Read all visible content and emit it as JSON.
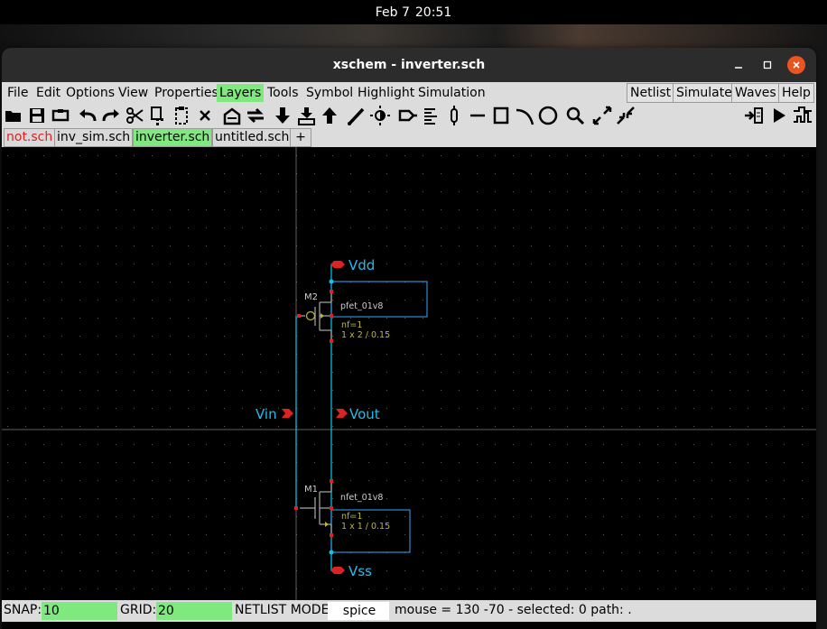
{
  "topbar": {
    "date": "Feb 7",
    "time": "20:51"
  },
  "window": {
    "title": "xschem - inverter.sch"
  },
  "menubar": {
    "items": [
      "File",
      "Edit",
      "Options",
      "View",
      "Properties",
      "Layers",
      "Tools",
      "Symbol",
      "Highlight",
      "Simulation"
    ],
    "active": "Layers",
    "right_buttons": [
      "Netlist",
      "Simulate",
      "Waves",
      "Help"
    ]
  },
  "toolbar": {
    "icons": [
      "open-folder-icon",
      "save-icon",
      "reload-icon",
      "undo-icon",
      "redo-icon",
      "cut-icon",
      "copy-icon",
      "paste-icon",
      "delete-icon",
      "rotate-icon",
      "flip-icon",
      "push-down-icon",
      "descend-symbol-icon",
      "go-up-icon",
      "wire-pencil-icon",
      "highlight-icon",
      "pin-icon",
      "text-align-icon",
      "resistor-icon",
      "line-icon",
      "rect-icon",
      "arc-icon",
      "circle-icon",
      "zoom-icon",
      "zoom-in-icon",
      "zoom-out-icon",
      "netlist-icon",
      "run-icon",
      "waveform-icon"
    ]
  },
  "tabs": [
    {
      "label": "not.sch",
      "state": "modified"
    },
    {
      "label": "inv_sim.sch",
      "state": "normal"
    },
    {
      "label": "inverter.sch",
      "state": "active"
    },
    {
      "label": "untitled.sch",
      "state": "normal"
    },
    {
      "label": "+",
      "state": "add"
    }
  ],
  "schematic": {
    "labels": {
      "vdd": "Vdd",
      "vss": "Vss",
      "vin": "Vin",
      "vout": "Vout"
    },
    "pmos": {
      "name": "M2",
      "model": "pfet_01v8",
      "nf": "nf=1",
      "size": "1 x 2 / 0.15"
    },
    "nmos": {
      "name": "M1",
      "model": "nfet_01v8",
      "nf": "nf=1",
      "size": "1 x 1 / 0.15"
    },
    "colors": {
      "wire": "#00ccee",
      "pin": "#ee2222",
      "device": "#aaaaaa",
      "param": "#bbbb33",
      "box": "#33aaff"
    }
  },
  "statusbar": {
    "snap_label": "SNAP:",
    "snap_value": "10",
    "grid_label": "GRID:",
    "grid_value": "20",
    "netlist_label": "NETLIST MODE:",
    "netlist_value": "spice",
    "info": "mouse = 130 -70 - selected: 0 path: ."
  }
}
